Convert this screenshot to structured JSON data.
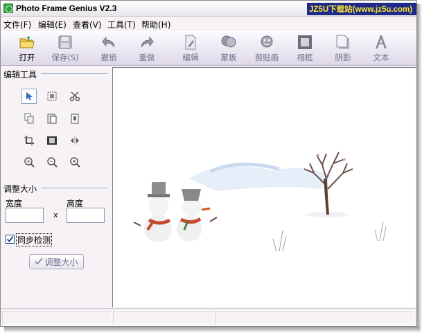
{
  "window": {
    "title": "Photo Frame Genius V2.3",
    "watermark": "JZ5U下载站(www.jz5u.com)"
  },
  "menu": [
    {
      "label": "文件(F)"
    },
    {
      "label": "编辑(E)"
    },
    {
      "label": "查看(V)"
    },
    {
      "label": "工具(T)"
    },
    {
      "label": "帮助(H)"
    }
  ],
  "toolbar": [
    {
      "label": "打开",
      "icon": "open-folder-icon",
      "enabled": true
    },
    {
      "label": "保存(S)",
      "icon": "save-disk-icon",
      "enabled": false
    },
    {
      "label": "撤销",
      "icon": "undo-arrow-icon",
      "enabled": false
    },
    {
      "label": "重做",
      "icon": "redo-arrow-icon",
      "enabled": false
    },
    {
      "label": "编辑",
      "icon": "edit-document-icon",
      "enabled": false
    },
    {
      "label": "蒙板",
      "icon": "mask-icon",
      "enabled": false
    },
    {
      "label": "剪贴画",
      "icon": "clipart-icon",
      "enabled": false
    },
    {
      "label": "相框",
      "icon": "photo-frame-icon",
      "enabled": false
    },
    {
      "label": "阴影",
      "icon": "shadow-icon",
      "enabled": false
    },
    {
      "label": "文本",
      "icon": "text-icon",
      "enabled": false
    }
  ],
  "edit_tools": {
    "header": "编辑工具",
    "tools": [
      {
        "icon": "pointer-arrow-icon",
        "selected": true
      },
      {
        "icon": "marquee-select-icon"
      },
      {
        "icon": "scissors-cut-icon"
      },
      {
        "icon": "copy-icon"
      },
      {
        "icon": "paste-icon"
      },
      {
        "icon": "paste-special-icon"
      },
      {
        "icon": "crop-icon"
      },
      {
        "icon": "frame-fit-icon"
      },
      {
        "icon": "flip-icon"
      },
      {
        "icon": "zoom-in-icon"
      },
      {
        "icon": "zoom-out-icon"
      },
      {
        "icon": "zoom-fit-icon"
      }
    ]
  },
  "resize": {
    "header": "调整大小",
    "width_label": "宽度",
    "height_label": "高度",
    "separator": "x",
    "width_value": "",
    "height_value": "",
    "sync_label": "同步检测",
    "sync_checked": true,
    "button_label": "调整大小"
  },
  "colors": {
    "watermark_bg": "#1d2a8a",
    "watermark_text": "#ffe62c",
    "section_line": "#8ea6c6",
    "disabled_text": "#6d6f8f"
  }
}
